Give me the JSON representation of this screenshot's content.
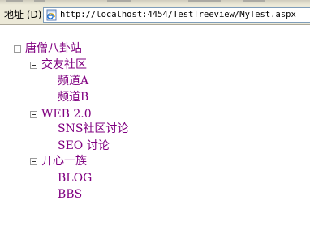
{
  "address_bar": {
    "label": "地址 (D)",
    "url": "http://localhost:4454/TestTreeview/MyTest.aspx"
  },
  "tree": {
    "root": {
      "label": "唐僧八卦站",
      "children": [
        {
          "label": "交友社区",
          "children": [
            {
              "label": "频道A"
            },
            {
              "label": "频道B"
            }
          ]
        },
        {
          "label": "WEB 2.0",
          "children": [
            {
              "label": "SNS社区讨论"
            },
            {
              "label": "SEO 讨论"
            }
          ]
        },
        {
          "label": "开心一族",
          "children": [
            {
              "label": "BLOG"
            },
            {
              "label": "BBS"
            }
          ]
        }
      ]
    }
  },
  "colors": {
    "link_visited": "#800080",
    "chrome": "#ece9d8",
    "field_border": "#7f9db9"
  },
  "icons": {
    "page": "ie-page-icon",
    "collapse": "tree-collapse-minus-icon"
  }
}
